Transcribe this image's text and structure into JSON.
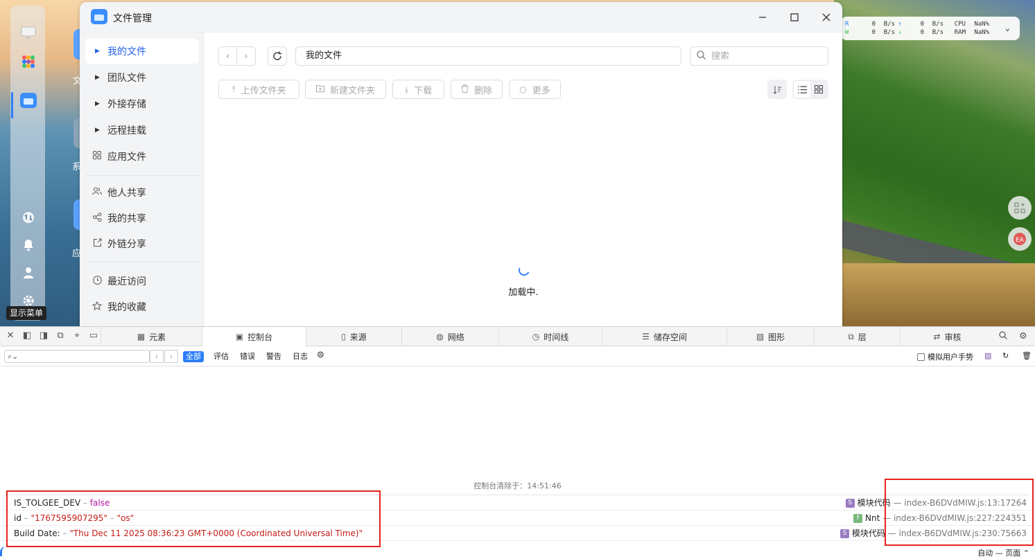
{
  "desktop": {
    "dock_tooltip": "显示菜单",
    "icon_labels": [
      "文",
      "系",
      "应"
    ],
    "monitor": {
      "r_label": "R",
      "w_label": "W",
      "r_down": "0",
      "r_down_unit": "B/s",
      "r_up": "0",
      "r_up_unit": "B/s",
      "w_down": "0",
      "w_down_unit": "B/s",
      "w_up": "0",
      "w_up_unit": "B/s",
      "cpu_label": "CPU",
      "cpu_value": "NaN%",
      "ram_label": "RAM",
      "ram_value": "NaN%"
    }
  },
  "window": {
    "title": "文件管理",
    "sidebar": {
      "group1": [
        "我的文件",
        "团队文件",
        "外接存储",
        "远程挂载"
      ],
      "app_files": "应用文件",
      "group2": [
        "他人共享",
        "我的共享",
        "外链分享"
      ],
      "group3": [
        "最近访问",
        "我的收藏"
      ]
    },
    "path": "我的文件",
    "search_placeholder": "搜索",
    "toolbar": {
      "upload": "上传文件夹",
      "new_folder": "新建文件夹",
      "download": "下载",
      "delete": "删除",
      "more": "更多"
    },
    "loading_text": "加载中."
  },
  "devtools": {
    "tabs": [
      "元素",
      "控制台",
      "来源",
      "网络",
      "时间线",
      "储存空间",
      "图形",
      "层",
      "审核"
    ],
    "active_tab": "控制台",
    "filters": [
      "全部",
      "评估",
      "错误",
      "警告",
      "日志"
    ],
    "emulate_gesture": "模拟用户手势",
    "cleared_text": "控制台清除于：14:51:46",
    "logs": [
      {
        "key": "IS_TOLGEE_DEV",
        "sep": "–",
        "value": "false",
        "badge": "S",
        "src_kind": "模块代码",
        "src_sep": "—",
        "location": "index-B6DVdMIW.js:13:17264"
      },
      {
        "key": "id",
        "sep": "–",
        "value": "\"1767595907295\"",
        "sep2": "–",
        "value2": "\"os\"",
        "badge": "f",
        "src_kind": "Nnt",
        "src_sep": "—",
        "location": "index-B6DVdMIW.js:227:224351"
      },
      {
        "key": "Build Date:",
        "sep": "–",
        "value": "\"Thu Dec 11 2025 08:36:23 GMT+0000 (Coordinated Universal Time)\"",
        "badge": "S",
        "src_kind": "模块代码",
        "src_sep": "—",
        "location": "index-B6DVdMIW.js:230:75663"
      }
    ],
    "zoom_select": "自动 — 页面"
  },
  "colors": {
    "accent": "#2d7ff9",
    "highlight_box": "#e5231b",
    "string_value": "#c41a16",
    "bool_value": "#b515a8"
  }
}
